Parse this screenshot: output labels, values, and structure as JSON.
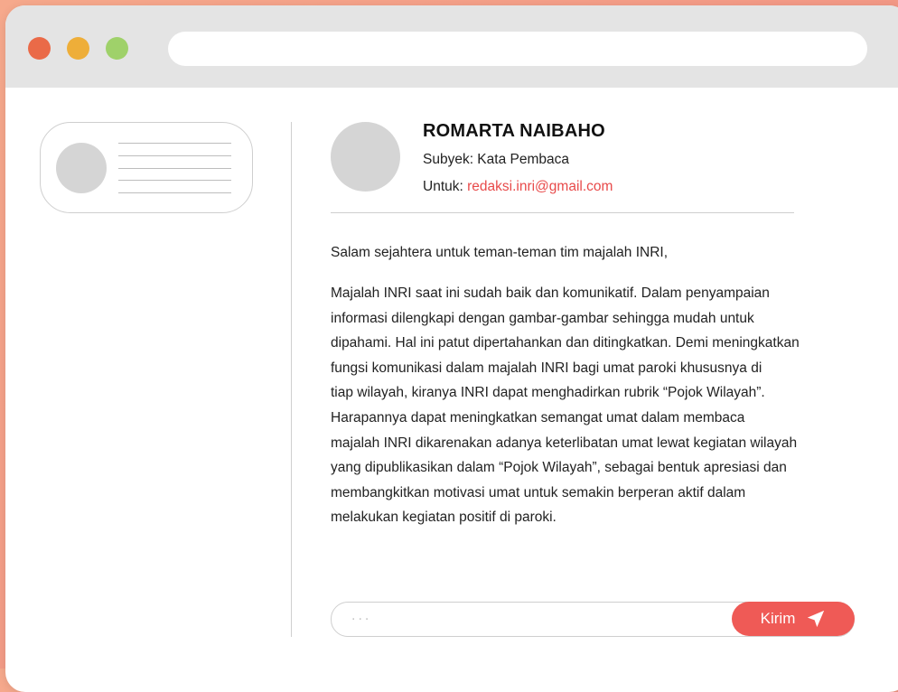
{
  "colors": {
    "background_gradient": [
      "#f6a98c",
      "#ee8f84"
    ],
    "window": "#ffffff",
    "titlebar": "#e4e4e4",
    "traffic_red": "#ea6a48",
    "traffic_yellow": "#eeae39",
    "traffic_green": "#9fd16a",
    "accent": "#ef5a56",
    "email_link": "#e84a4a"
  },
  "titlebar": {
    "controls": [
      "close-dot",
      "minimize-dot",
      "zoom-dot"
    ],
    "address_value": ""
  },
  "message": {
    "sender_name": "ROMARTA NAIBAHO",
    "subject": "Subyek: Kata Pembaca",
    "to_label": "Untuk: ",
    "to_email": "redaksi.inri@gmail.com",
    "greeting": "Salam sejahtera untuk teman-teman tim majalah INRI,",
    "body_lines": [
      "Majalah INRI saat ini sudah baik dan komunikatif. Dalam penyampaian",
      "informasi dilengkapi dengan gambar-gambar sehingga mudah untuk",
      "dipahami. Hal ini patut dipertahankan dan ditingkatkan. Demi meningkatkan",
      "fungsi komunikasi dalam majalah INRI bagi umat paroki khususnya di",
      "tiap wilayah, kiranya INRI dapat menghadirkan rubrik “Pojok Wilayah”.",
      "Harapannya dapat meningkatkan semangat umat dalam membaca",
      "majalah INRI dikarenakan adanya keterlibatan umat lewat kegiatan wilayah",
      "yang dipublikasikan dalam “Pojok Wilayah”, sebagai bentuk apresiasi dan",
      "membangkitkan motivasi umat untuk semakin berperan aktif dalam",
      "melakukan kegiatan positif di paroki."
    ]
  },
  "reply": {
    "placeholder": "...",
    "send_label": "Kirim",
    "send_icon": "paper-plane-icon"
  }
}
